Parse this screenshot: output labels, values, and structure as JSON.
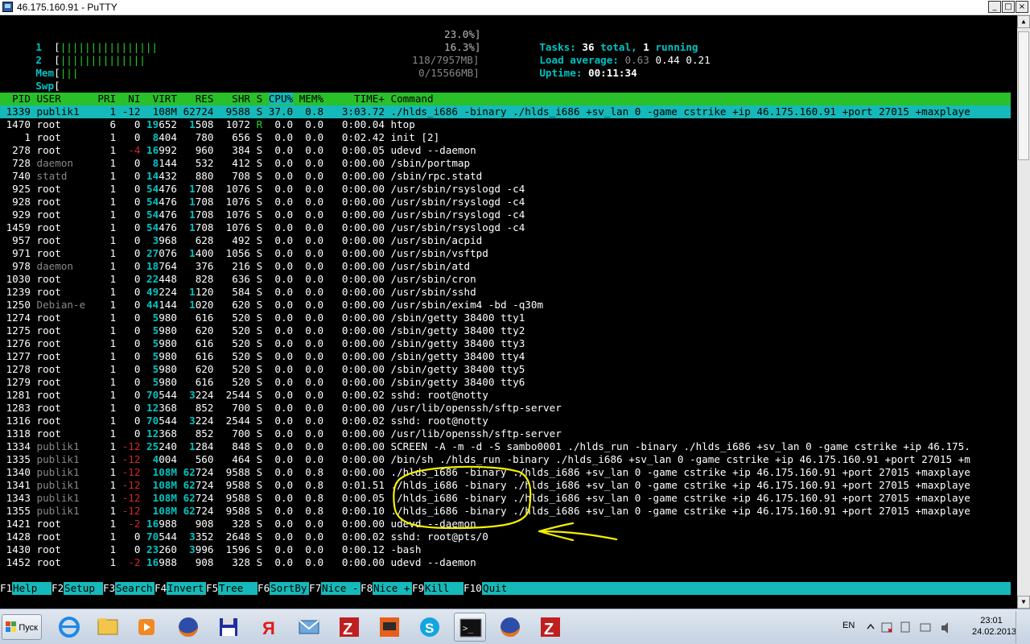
{
  "window": {
    "title": "46.175.160.91 - PuTTY",
    "min_label": "_",
    "max_label": "□",
    "close_label": "×"
  },
  "meters": {
    "cpu1": {
      "label": "1",
      "bars": "||||||||||||||||",
      "value": "23.0%]"
    },
    "cpu2": {
      "label": "2",
      "bars": "||||||||||||||",
      "value": "16.3%]"
    },
    "mem": {
      "label": "Mem",
      "bars": "|||",
      "value": "118/7957MB]"
    },
    "swp": {
      "label": "Swp",
      "bars": "",
      "value": "0/15566MB]"
    },
    "tasks_label": "Tasks: ",
    "tasks_total": "36",
    "tasks_mid": " total, ",
    "tasks_running": "1",
    "tasks_end": " running",
    "load_label": "Load average: ",
    "load1": "0.63",
    "load5": "0.44",
    "load15": "0.21",
    "uptime_label": "Uptime: ",
    "uptime": "00:11:34"
  },
  "columns": [
    "PID",
    "USER",
    "PRI",
    "NI",
    "VIRT",
    "RES",
    "SHR",
    "S",
    "CPU%",
    "MEM%",
    "TIME+",
    "Command"
  ],
  "processes": [
    {
      "pid": "1339",
      "user": "publik1",
      "pri": "1",
      "ni": "-12",
      "virt": "108M",
      "res": "62724",
      "shr": "9588",
      "s": "S",
      "cpu": "37.0",
      "mem": "0.8",
      "time": "3:03.72",
      "cmd": "./hlds_i686 -binary ./hlds_i686 +sv_lan 0 -game cstrike +ip 46.175.160.91 +port 27015 +maxplaye",
      "selected": true
    },
    {
      "pid": "1470",
      "user": "root",
      "pri": "6",
      "ni": "0",
      "virt": "19652",
      "res": "1508",
      "shr": "1072",
      "s": "R",
      "cpu": "0.0",
      "mem": "0.0",
      "time": "0:00.04",
      "cmd": "htop"
    },
    {
      "pid": "1",
      "user": "root",
      "pri": "1",
      "ni": "0",
      "virt": "8404",
      "res": "780",
      "shr": "656",
      "s": "S",
      "cpu": "0.0",
      "mem": "0.0",
      "time": "0:02.42",
      "cmd": "init [2]"
    },
    {
      "pid": "278",
      "user": "root",
      "pri": "1",
      "ni": "-4",
      "virt": "16992",
      "res": "960",
      "shr": "384",
      "s": "S",
      "cpu": "0.0",
      "mem": "0.0",
      "time": "0:00.05",
      "cmd": "udevd --daemon"
    },
    {
      "pid": "728",
      "user": "daemon",
      "pri": "1",
      "ni": "0",
      "virt": "8144",
      "res": "532",
      "shr": "412",
      "s": "S",
      "cpu": "0.0",
      "mem": "0.0",
      "time": "0:00.00",
      "cmd": "/sbin/portmap"
    },
    {
      "pid": "740",
      "user": "statd",
      "pri": "1",
      "ni": "0",
      "virt": "14432",
      "res": "880",
      "shr": "708",
      "s": "S",
      "cpu": "0.0",
      "mem": "0.0",
      "time": "0:00.00",
      "cmd": "/sbin/rpc.statd"
    },
    {
      "pid": "925",
      "user": "root",
      "pri": "1",
      "ni": "0",
      "virt": "54476",
      "res": "1708",
      "shr": "1076",
      "s": "S",
      "cpu": "0.0",
      "mem": "0.0",
      "time": "0:00.00",
      "cmd": "/usr/sbin/rsyslogd -c4"
    },
    {
      "pid": "928",
      "user": "root",
      "pri": "1",
      "ni": "0",
      "virt": "54476",
      "res": "1708",
      "shr": "1076",
      "s": "S",
      "cpu": "0.0",
      "mem": "0.0",
      "time": "0:00.00",
      "cmd": "/usr/sbin/rsyslogd -c4"
    },
    {
      "pid": "929",
      "user": "root",
      "pri": "1",
      "ni": "0",
      "virt": "54476",
      "res": "1708",
      "shr": "1076",
      "s": "S",
      "cpu": "0.0",
      "mem": "0.0",
      "time": "0:00.00",
      "cmd": "/usr/sbin/rsyslogd -c4"
    },
    {
      "pid": "1459",
      "user": "root",
      "pri": "1",
      "ni": "0",
      "virt": "54476",
      "res": "1708",
      "shr": "1076",
      "s": "S",
      "cpu": "0.0",
      "mem": "0.0",
      "time": "0:00.00",
      "cmd": "/usr/sbin/rsyslogd -c4"
    },
    {
      "pid": "957",
      "user": "root",
      "pri": "1",
      "ni": "0",
      "virt": "3968",
      "res": "628",
      "shr": "492",
      "s": "S",
      "cpu": "0.0",
      "mem": "0.0",
      "time": "0:00.00",
      "cmd": "/usr/sbin/acpid"
    },
    {
      "pid": "971",
      "user": "root",
      "pri": "1",
      "ni": "0",
      "virt": "27076",
      "res": "1400",
      "shr": "1056",
      "s": "S",
      "cpu": "0.0",
      "mem": "0.0",
      "time": "0:00.00",
      "cmd": "/usr/sbin/vsftpd"
    },
    {
      "pid": "978",
      "user": "daemon",
      "pri": "1",
      "ni": "0",
      "virt": "18764",
      "res": "376",
      "shr": "216",
      "s": "S",
      "cpu": "0.0",
      "mem": "0.0",
      "time": "0:00.00",
      "cmd": "/usr/sbin/atd"
    },
    {
      "pid": "1030",
      "user": "root",
      "pri": "1",
      "ni": "0",
      "virt": "22448",
      "res": "828",
      "shr": "636",
      "s": "S",
      "cpu": "0.0",
      "mem": "0.0",
      "time": "0:00.00",
      "cmd": "/usr/sbin/cron"
    },
    {
      "pid": "1239",
      "user": "root",
      "pri": "1",
      "ni": "0",
      "virt": "49224",
      "res": "1120",
      "shr": "584",
      "s": "S",
      "cpu": "0.0",
      "mem": "0.0",
      "time": "0:00.00",
      "cmd": "/usr/sbin/sshd"
    },
    {
      "pid": "1250",
      "user": "Debian-e",
      "pri": "1",
      "ni": "0",
      "virt": "44144",
      "res": "1020",
      "shr": "620",
      "s": "S",
      "cpu": "0.0",
      "mem": "0.0",
      "time": "0:00.00",
      "cmd": "/usr/sbin/exim4 -bd -q30m"
    },
    {
      "pid": "1274",
      "user": "root",
      "pri": "1",
      "ni": "0",
      "virt": "5980",
      "res": "616",
      "shr": "520",
      "s": "S",
      "cpu": "0.0",
      "mem": "0.0",
      "time": "0:00.00",
      "cmd": "/sbin/getty 38400 tty1"
    },
    {
      "pid": "1275",
      "user": "root",
      "pri": "1",
      "ni": "0",
      "virt": "5980",
      "res": "620",
      "shr": "520",
      "s": "S",
      "cpu": "0.0",
      "mem": "0.0",
      "time": "0:00.00",
      "cmd": "/sbin/getty 38400 tty2"
    },
    {
      "pid": "1276",
      "user": "root",
      "pri": "1",
      "ni": "0",
      "virt": "5980",
      "res": "616",
      "shr": "520",
      "s": "S",
      "cpu": "0.0",
      "mem": "0.0",
      "time": "0:00.00",
      "cmd": "/sbin/getty 38400 tty3"
    },
    {
      "pid": "1277",
      "user": "root",
      "pri": "1",
      "ni": "0",
      "virt": "5980",
      "res": "616",
      "shr": "520",
      "s": "S",
      "cpu": "0.0",
      "mem": "0.0",
      "time": "0:00.00",
      "cmd": "/sbin/getty 38400 tty4"
    },
    {
      "pid": "1278",
      "user": "root",
      "pri": "1",
      "ni": "0",
      "virt": "5980",
      "res": "620",
      "shr": "520",
      "s": "S",
      "cpu": "0.0",
      "mem": "0.0",
      "time": "0:00.00",
      "cmd": "/sbin/getty 38400 tty5"
    },
    {
      "pid": "1279",
      "user": "root",
      "pri": "1",
      "ni": "0",
      "virt": "5980",
      "res": "616",
      "shr": "520",
      "s": "S",
      "cpu": "0.0",
      "mem": "0.0",
      "time": "0:00.00",
      "cmd": "/sbin/getty 38400 tty6"
    },
    {
      "pid": "1281",
      "user": "root",
      "pri": "1",
      "ni": "0",
      "virt": "70544",
      "res": "3224",
      "shr": "2544",
      "s": "S",
      "cpu": "0.0",
      "mem": "0.0",
      "time": "0:00.02",
      "cmd": "sshd: root@notty"
    },
    {
      "pid": "1283",
      "user": "root",
      "pri": "1",
      "ni": "0",
      "virt": "12368",
      "res": "852",
      "shr": "700",
      "s": "S",
      "cpu": "0.0",
      "mem": "0.0",
      "time": "0:00.00",
      "cmd": "/usr/lib/openssh/sftp-server"
    },
    {
      "pid": "1316",
      "user": "root",
      "pri": "1",
      "ni": "0",
      "virt": "70544",
      "res": "3224",
      "shr": "2544",
      "s": "S",
      "cpu": "0.0",
      "mem": "0.0",
      "time": "0:00.02",
      "cmd": "sshd: root@notty"
    },
    {
      "pid": "1318",
      "user": "root",
      "pri": "1",
      "ni": "0",
      "virt": "12368",
      "res": "852",
      "shr": "700",
      "s": "S",
      "cpu": "0.0",
      "mem": "0.0",
      "time": "0:00.00",
      "cmd": "/usr/lib/openssh/sftp-server"
    },
    {
      "pid": "1334",
      "user": "publik1",
      "pri": "1",
      "ni": "-12",
      "virt": "25240",
      "res": "1284",
      "shr": "848",
      "s": "S",
      "cpu": "0.0",
      "mem": "0.0",
      "time": "0:00.00",
      "cmd": "SCREEN -A -m -d -S sambo0001 ./hlds_run -binary ./hlds_i686 +sv_lan 0 -game cstrike +ip 46.175."
    },
    {
      "pid": "1335",
      "user": "publik1",
      "pri": "1",
      "ni": "-12",
      "virt": "4004",
      "res": "560",
      "shr": "464",
      "s": "S",
      "cpu": "0.0",
      "mem": "0.0",
      "time": "0:00.00",
      "cmd": "/bin/sh ./hlds_run -binary ./hlds_i686 +sv_lan 0 -game cstrike +ip 46.175.160.91 +port 27015 +m"
    },
    {
      "pid": "1340",
      "user": "publik1",
      "pri": "1",
      "ni": "-12",
      "virt": "108M",
      "res": "62724",
      "shr": "9588",
      "s": "S",
      "cpu": "0.0",
      "mem": "0.8",
      "time": "0:00.00",
      "cmd": "./hlds_i686 -binary ./hlds_i686 +sv_lan 0 -game cstrike +ip 46.175.160.91 +port 27015 +maxplaye"
    },
    {
      "pid": "1341",
      "user": "publik1",
      "pri": "1",
      "ni": "-12",
      "virt": "108M",
      "res": "62724",
      "shr": "9588",
      "s": "S",
      "cpu": "0.0",
      "mem": "0.8",
      "time": "0:01.51",
      "cmd": "./hlds_i686 -binary ./hlds_i686 +sv_lan 0 -game cstrike +ip 46.175.160.91 +port 27015 +maxplaye"
    },
    {
      "pid": "1343",
      "user": "publik1",
      "pri": "1",
      "ni": "-12",
      "virt": "108M",
      "res": "62724",
      "shr": "9588",
      "s": "S",
      "cpu": "0.0",
      "mem": "0.8",
      "time": "0:00.05",
      "cmd": "./hlds_i686 -binary ./hlds_i686 +sv_lan 0 -game cstrike +ip 46.175.160.91 +port 27015 +maxplaye"
    },
    {
      "pid": "1355",
      "user": "publik1",
      "pri": "1",
      "ni": "-12",
      "virt": "108M",
      "res": "62724",
      "shr": "9588",
      "s": "S",
      "cpu": "0.0",
      "mem": "0.8",
      "time": "0:00.10",
      "cmd": "./hlds_i686 -binary ./hlds_i686 +sv_lan 0 -game cstrike +ip 46.175.160.91 +port 27015 +maxplaye"
    },
    {
      "pid": "1421",
      "user": "root",
      "pri": "1",
      "ni": "-2",
      "virt": "16988",
      "res": "908",
      "shr": "328",
      "s": "S",
      "cpu": "0.0",
      "mem": "0.0",
      "time": "0:00.00",
      "cmd": "udevd --daemon"
    },
    {
      "pid": "1428",
      "user": "root",
      "pri": "1",
      "ni": "0",
      "virt": "70544",
      "res": "3352",
      "shr": "2648",
      "s": "S",
      "cpu": "0.0",
      "mem": "0.0",
      "time": "0:00.02",
      "cmd": "sshd: root@pts/0"
    },
    {
      "pid": "1430",
      "user": "root",
      "pri": "1",
      "ni": "0",
      "virt": "23260",
      "res": "3996",
      "shr": "1596",
      "s": "S",
      "cpu": "0.0",
      "mem": "0.0",
      "time": "0:00.12",
      "cmd": "-bash"
    },
    {
      "pid": "1452",
      "user": "root",
      "pri": "1",
      "ni": "-2",
      "virt": "16988",
      "res": "908",
      "shr": "328",
      "s": "S",
      "cpu": "0.0",
      "mem": "0.0",
      "time": "0:00.00",
      "cmd": "udevd --daemon"
    }
  ],
  "function_keys": [
    {
      "key": "F1",
      "label": "Help"
    },
    {
      "key": "F2",
      "label": "Setup"
    },
    {
      "key": "F3",
      "label": "Search"
    },
    {
      "key": "F4",
      "label": "Invert"
    },
    {
      "key": "F5",
      "label": "Tree"
    },
    {
      "key": "F6",
      "label": "SortBy"
    },
    {
      "key": "F7",
      "label": "Nice -"
    },
    {
      "key": "F8",
      "label": "Nice +"
    },
    {
      "key": "F9",
      "label": "Kill"
    },
    {
      "key": "F10",
      "label": "Quit"
    }
  ],
  "taskbar": {
    "start_label": "Пуск",
    "apps": [
      "internet-explorer",
      "file-explorer",
      "media-player",
      "firefox",
      "save-disk",
      "yandex-browser",
      "mail",
      "filezilla",
      "game-app",
      "skype",
      "command-prompt",
      "firefox",
      "filezilla"
    ],
    "lang": "EN",
    "time": "23:01",
    "date": "24.02.2013"
  },
  "colors": {
    "header_bar": "#2ac02a",
    "selection_bar": "#15b9b9",
    "annotation": "#f5f000"
  }
}
